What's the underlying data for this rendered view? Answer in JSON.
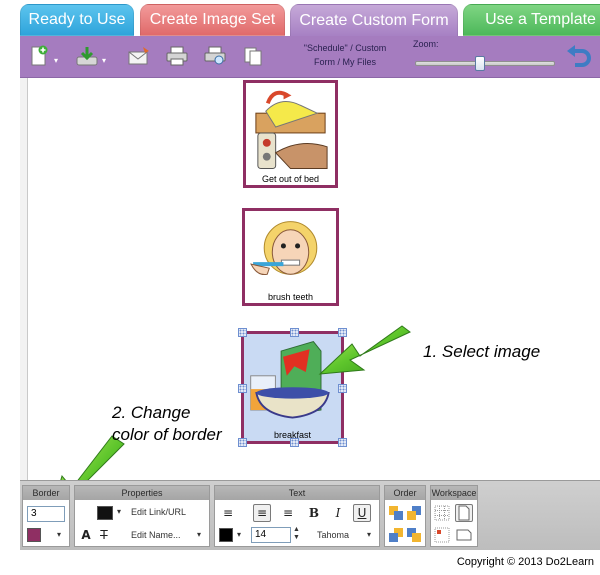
{
  "tabs": [
    {
      "label": "Ready to Use",
      "color": "#2fa4db"
    },
    {
      "label": "Create Image Set",
      "color": "#e06a6a"
    },
    {
      "label": "Create Custom Form",
      "color": "#a67fc3"
    },
    {
      "label": "Use a Template",
      "color": "#4db85a"
    }
  ],
  "toolbar": {
    "caption_line1": "\"Schedule\" / Custom",
    "caption_line2": "Form / My Files",
    "zoom_label": "Zoom:",
    "zoom_level": 0.45,
    "icons": [
      "new-page-icon",
      "download-icon",
      "email-icon",
      "print-icon",
      "print-preview-icon",
      "copy-icon",
      "undo-icon"
    ]
  },
  "cards": [
    {
      "caption": "Get out of bed"
    },
    {
      "caption": "brush teeth"
    },
    {
      "caption": "breakfast"
    }
  ],
  "annotations": {
    "step1": "1. Select image",
    "step2_line1": "2. Change",
    "step2_line2": "color of border"
  },
  "properties_bar": {
    "border_title": "Border",
    "border_width": "3",
    "border_color": "#8f2f63",
    "properties_title": "Properties",
    "edit_link": "Edit Link/URL",
    "edit_name": "Edit Name...",
    "text_title": "Text",
    "font_size": "14",
    "font_name": "Tahoma",
    "text_color": "#000000",
    "order_title": "Order",
    "workspace_title": "Workspace"
  },
  "copyright": "Copyright © 2013 Do2Learn"
}
